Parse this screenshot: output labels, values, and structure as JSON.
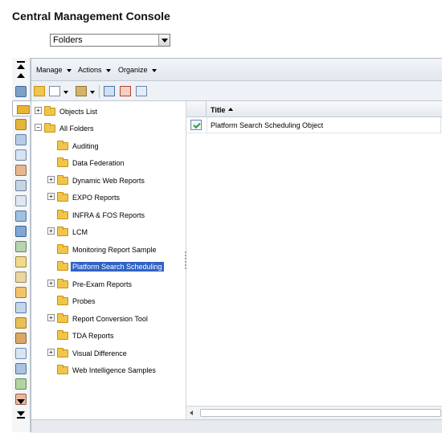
{
  "header": {
    "title": "Central Management Console"
  },
  "view_select": {
    "value": "Folders"
  },
  "menubar": [
    {
      "label": "Manage"
    },
    {
      "label": "Actions"
    },
    {
      "label": "Organize"
    }
  ],
  "toolbar": {
    "icons": [
      "new-folder-icon",
      "new-object-icon",
      "organize-icon",
      "properties-icon",
      "user-security-icon",
      "refresh-icon"
    ]
  },
  "rail_icons": [
    "home-icon",
    "folders-icon",
    "personal-folders-icon",
    "inbox-icon",
    "categories-icon",
    "users-groups-icon",
    "servers-icon",
    "universes-icon",
    "connections-icon",
    "server-groups-icon",
    "access-levels-icon",
    "calendars-icon",
    "events-icon",
    "applications-icon",
    "settings-icon",
    "authentication-icon",
    "license-keys-icon",
    "sessions-icon",
    "instance-manager-icon",
    "federation-icon",
    "query-results-icon"
  ],
  "tree": {
    "items": [
      {
        "label": "Objects List"
      },
      {
        "label": "All Folders"
      },
      {
        "label": "Auditing"
      },
      {
        "label": "Data Federation"
      },
      {
        "label": "Dynamic Web Reports"
      },
      {
        "label": "EXPO Reports"
      },
      {
        "label": "INFRA & FOS Reports"
      },
      {
        "label": "LCM"
      },
      {
        "label": "Monitoring Report Sample"
      },
      {
        "label": "Platform Search Scheduling"
      },
      {
        "label": "Pre-Exam Reports"
      },
      {
        "label": "Probes"
      },
      {
        "label": "Report Conversion Tool"
      },
      {
        "label": "TDA Reports"
      },
      {
        "label": "Visual Difference"
      },
      {
        "label": "Web Intelligence Samples"
      }
    ],
    "selected": "Platform Search Scheduling"
  },
  "list": {
    "columns": [
      {
        "label": "Title",
        "sort": "ascending"
      }
    ],
    "rows": [
      {
        "title": "Platform Search Scheduling Object"
      }
    ]
  },
  "colors": {
    "selection": "#3163c5",
    "folder": "#f0c54a",
    "panel_bg": "#eef1f5"
  }
}
